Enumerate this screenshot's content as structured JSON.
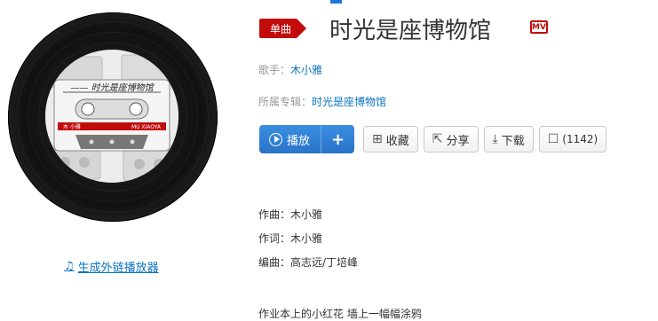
{
  "header": {
    "single_badge": "单曲",
    "song_title": "时光是座博物馆",
    "mv_label": "MV"
  },
  "meta": {
    "singer_label": "歌手：",
    "singer": "木小雅",
    "album_label": "所属专辑：",
    "album": "时光是座博物馆"
  },
  "buttons": {
    "play": "播放",
    "add": "+",
    "collect": "收藏",
    "share": "分享",
    "download": "下载",
    "comment": "(1142)"
  },
  "cover": {
    "title_text": "时光是座博物馆",
    "tape_left": "木 小雅",
    "tape_right": "MU XIAOYA"
  },
  "player_link": "生成外链播放器",
  "credits": {
    "composer": "作曲：木小雅",
    "lyricist": "作词：木小雅",
    "arranger": "编曲：高志远/丁培峰"
  },
  "lyrics_first_line": "作业本上的小红花 墙上一幅幅涂鸦",
  "colors": {
    "accent_red": "#c20c0c",
    "link_blue": "#0c73c2",
    "play_blue": "#2a74c8"
  }
}
